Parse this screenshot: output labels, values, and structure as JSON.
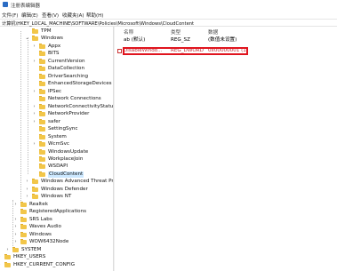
{
  "window": {
    "title": "注册表编辑器"
  },
  "menu": [
    "文件(F)",
    "编辑(E)",
    "查看(V)",
    "收藏夹(A)",
    "帮助(H)"
  ],
  "address": "计算机\\HKEY_LOCAL_MACHINE\\SOFTWARE\\Policies\\Microsoft\\Windows\\CloudContent",
  "tree": [
    {
      "label": "TPM",
      "chevron": "",
      "depth": 0
    },
    {
      "label": "Windows",
      "chevron": "v",
      "depth": 0
    },
    {
      "label": "Appx",
      "chevron": ">",
      "depth": 1
    },
    {
      "label": "BITS",
      "chevron": "",
      "depth": 1
    },
    {
      "label": "CurrentVersion",
      "chevron": ">",
      "depth": 1
    },
    {
      "label": "DataCollection",
      "chevron": "",
      "depth": 1
    },
    {
      "label": "DriverSearching",
      "chevron": "",
      "depth": 1
    },
    {
      "label": "EnhancedStorageDevices",
      "chevron": "",
      "depth": 1
    },
    {
      "label": "IPSec",
      "chevron": ">",
      "depth": 1
    },
    {
      "label": "Network Connections",
      "chevron": "",
      "depth": 1
    },
    {
      "label": "NetworkConnectivityStatusInc",
      "chevron": ">",
      "depth": 1
    },
    {
      "label": "NetworkProvider",
      "chevron": ">",
      "depth": 1
    },
    {
      "label": "safer",
      "chevron": ">",
      "depth": 1
    },
    {
      "label": "SettingSync",
      "chevron": "",
      "depth": 1
    },
    {
      "label": "System",
      "chevron": "",
      "depth": 1
    },
    {
      "label": "WcmSvc",
      "chevron": ">",
      "depth": 1
    },
    {
      "label": "WindowsUpdate",
      "chevron": "",
      "depth": 1
    },
    {
      "label": "WorkplaceJoin",
      "chevron": "",
      "depth": 1
    },
    {
      "label": "WSDAPI",
      "chevron": "",
      "depth": 1
    },
    {
      "label": "CloudContent",
      "chevron": "",
      "depth": 1,
      "selected": true
    },
    {
      "label": "Windows Advanced Threat Prote",
      "chevron": ">",
      "depth": 0
    },
    {
      "label": "Windows Defender",
      "chevron": ">",
      "depth": 0
    },
    {
      "label": "Windows NT",
      "chevron": ">",
      "depth": 0
    },
    {
      "label": "Realtek",
      "chevron": ">",
      "depth": -1
    },
    {
      "label": "RegisteredApplications",
      "chevron": "",
      "depth": -1
    },
    {
      "label": "SRS Labs",
      "chevron": ">",
      "depth": -1
    },
    {
      "label": "Waves Audio",
      "chevron": ">",
      "depth": -1
    },
    {
      "label": "Windows",
      "chevron": ">",
      "depth": -1
    },
    {
      "label": "WOW6432Node",
      "chevron": ">",
      "depth": -1
    },
    {
      "label": "SYSTEM",
      "chevron": ">",
      "depth": -2
    },
    {
      "label": "HKEY_USERS",
      "chevron": ">",
      "depth": -3
    },
    {
      "label": "HKEY_CURRENT_CONFIG",
      "chevron": ">",
      "depth": -3
    }
  ],
  "columns": {
    "name": "名称",
    "type": "类型",
    "data": "数据"
  },
  "values": [
    {
      "name": "ab (默认)",
      "type": "REG_SZ",
      "data": "(数值未设置)",
      "icon": "string-value-icon"
    },
    {
      "name": "DisableWindo...",
      "type": "REG_DWORD",
      "data": "0x00000001 (1)",
      "icon": "dword-value-icon",
      "highlight": true
    }
  ]
}
